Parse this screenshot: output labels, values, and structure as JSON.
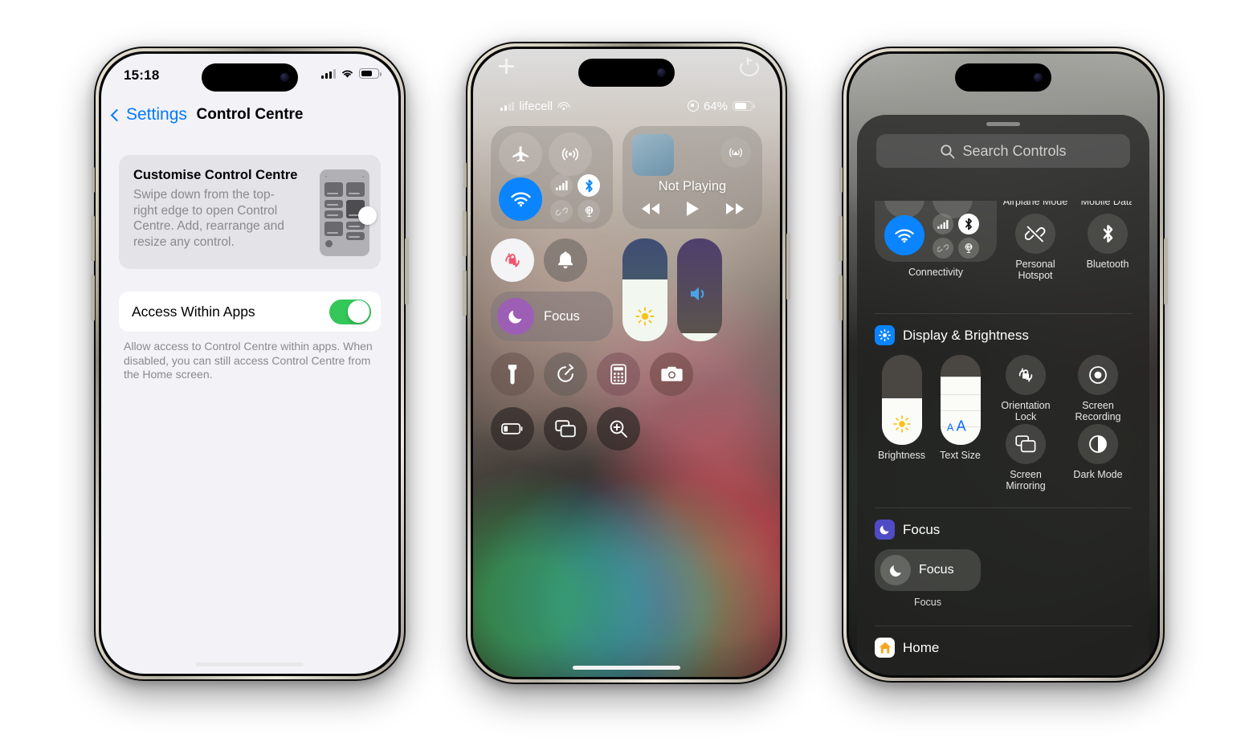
{
  "phone1": {
    "status_bar": {
      "time": "15:18",
      "signal_icon": "cellular-bars-icon",
      "wifi_icon": "wifi-icon",
      "battery_icon": "battery-icon"
    },
    "nav": {
      "back_label": "Settings",
      "title": "Control Centre",
      "back_chevron": "chevron-left-icon"
    },
    "customise_card": {
      "heading": "Customise Control Centre",
      "body": "Swipe down from the top-right edge to open Control Centre. Add, rearrange and resize any control."
    },
    "access_row": {
      "label": "Access Within Apps",
      "toggle_state": "on",
      "toggle_color": "#34c759"
    },
    "access_footnote": "Allow access to Control Centre within apps. When disabled, you can still access Control Centre from the Home screen."
  },
  "phone2": {
    "top_bar": {
      "add_icon": "plus-icon",
      "power_icon": "power-icon"
    },
    "status_bar": {
      "carrier": "lifecell",
      "battery_percent": "64%",
      "orientation_lock_icon": "rotation-lock-icon",
      "signal_icon": "cellular-bars-icon",
      "wifi_icon": "wifi-icon",
      "battery_icon": "battery-icon"
    },
    "connectivity": {
      "airplane_icon": "airplane-icon",
      "airplane_state": "off",
      "airdrop_icon": "airdrop-icon",
      "airdrop_state": "off",
      "wifi_icon": "wifi-icon",
      "wifi_state": "on",
      "cellular_icon": "cellular-bars-icon",
      "cellular_state": "off",
      "bluetooth_icon": "bluetooth-icon",
      "bluetooth_state": "on",
      "hotspot_icon": "personal-hotspot-icon",
      "hotspot_state": "off",
      "vpn_icon": "vpn-icon",
      "vpn_state": "off"
    },
    "media": {
      "title": "Not Playing",
      "airplay_icon": "airplay-audio-icon",
      "prev_icon": "rewind-icon",
      "play_icon": "play-icon",
      "next_icon": "fast-forward-icon"
    },
    "quick": {
      "orientation_lock_icon": "orientation-lock-icon",
      "orientation_lock_state": "on",
      "ring_icon": "bell-icon",
      "ring_state": "off"
    },
    "focus": {
      "label": "Focus",
      "icon": "moon-icon"
    },
    "brightness": {
      "icon": "sun-icon",
      "level_percent": 60
    },
    "volume": {
      "icon": "speaker-icon",
      "level_percent": 8
    },
    "row3": [
      {
        "name": "flashlight",
        "icon": "flashlight-icon"
      },
      {
        "name": "timer",
        "icon": "timer-icon"
      },
      {
        "name": "calculator",
        "icon": "calculator-icon"
      },
      {
        "name": "camera",
        "icon": "camera-icon"
      }
    ],
    "row4": [
      {
        "name": "low-power-mode",
        "icon": "battery-low-icon"
      },
      {
        "name": "screen-mirroring",
        "icon": "screen-mirroring-icon"
      },
      {
        "name": "magnifier",
        "icon": "magnifier-icon"
      }
    ]
  },
  "phone3": {
    "search": {
      "placeholder": "Search Controls",
      "icon": "search-icon"
    },
    "top_group": {
      "connectivity_label": "Connectivity",
      "items": [
        {
          "label": "Airplane Mode",
          "icon": "airplane-icon"
        },
        {
          "label": "Mobile Data",
          "icon": "cellular-bars-icon"
        },
        {
          "label": "Personal Hotspot",
          "icon": "personal-hotspot-off-icon"
        },
        {
          "label": "Bluetooth",
          "icon": "bluetooth-icon"
        }
      ]
    },
    "display_group": {
      "title": "Display & Brightness",
      "icon": "brightness-app-icon",
      "icon_color": "#0a84ff",
      "brightness": {
        "label": "Brightness",
        "icon": "sun-icon",
        "level_percent": 52
      },
      "text_size": {
        "label": "Text Size",
        "icon": "text-size-icon",
        "level_percent": 76
      },
      "items": [
        {
          "label": "Orientation Lock",
          "icon": "orientation-lock-icon"
        },
        {
          "label": "Screen Recording",
          "icon": "screen-recording-icon"
        },
        {
          "label": "Screen Mirroring",
          "icon": "screen-mirroring-icon"
        },
        {
          "label": "Dark Mode",
          "icon": "dark-mode-icon"
        }
      ]
    },
    "focus_group": {
      "title": "Focus",
      "icon": "moon-icon",
      "icon_color": "#4f4bc4",
      "card_label": "Focus",
      "card_icon": "moon-icon",
      "caption": "Focus"
    },
    "home_group": {
      "title": "Home",
      "icon": "home-app-icon",
      "icon_color": "#f5a623"
    }
  }
}
